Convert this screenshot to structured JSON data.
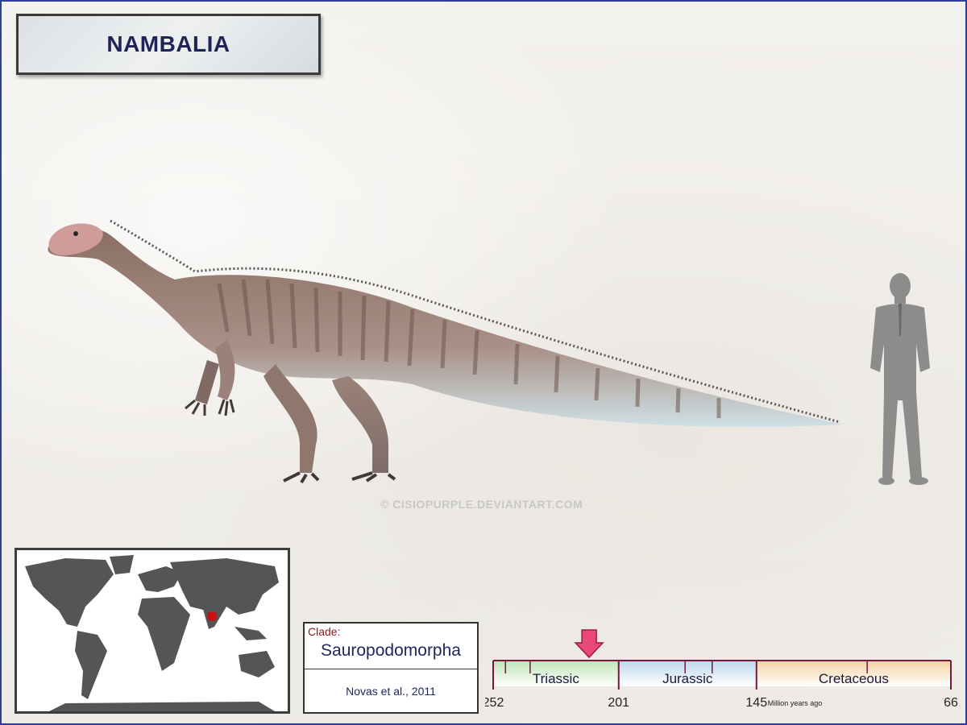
{
  "title": "NAMBALIA",
  "watermark": "© CISIOPURPLE.DEVIANTART.COM",
  "clade": {
    "label": "Clade:",
    "value": "Sauropodomorpha",
    "author": "Novas et al., 2011"
  },
  "timeline": {
    "periods": [
      {
        "name": "Triassic",
        "start": 252,
        "end": 201,
        "color": "#bfe3b5"
      },
      {
        "name": "Jurassic",
        "start": 201,
        "end": 145,
        "color": "#bcd8ec"
      },
      {
        "name": "Cretaceous",
        "start": 145,
        "end": 66,
        "color": "#f3d2a4"
      }
    ],
    "labels": [
      "252",
      "201",
      "145",
      "66"
    ],
    "unit": "Million years ago",
    "marker_ma": 213,
    "marker_color": "#e8487a"
  },
  "map": {
    "location_color": "#cc1010",
    "land_color": "#555555"
  }
}
